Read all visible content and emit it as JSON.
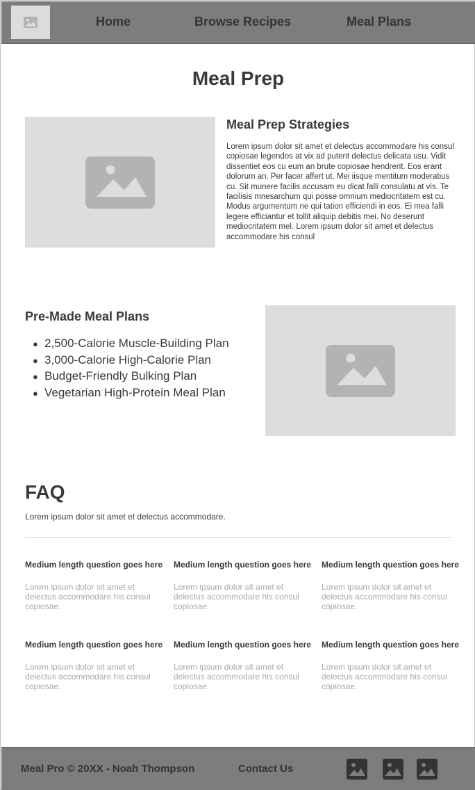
{
  "header": {
    "nav": [
      {
        "label": "Home"
      },
      {
        "label": "Browse Recipes"
      },
      {
        "label": "Meal Plans"
      }
    ]
  },
  "page_title": "Meal Prep",
  "strategies": {
    "heading": "Meal Prep Strategies",
    "body": "Lorem ipsum dolor sit amet et delectus accommodare his consul copiosae legendos at vix ad putent delectus delicata usu. Vidit dissentiet eos cu eum an brute copiosae hendrerit. Eos erant dolorum an. Per facer affert ut. Mei iisque mentitum moderatius cu. Sit munere facilis accusam eu dicat falli consulatu at vis. Te facilisis mnesarchum qui posse omnium mediocritatem est cu. Modus argumentum ne qui tation efficiendi in eos. Ei mea falli legere efficiantur et tollit aliquip debitis mei. No deserunt mediocritatem mel. Lorem ipsum dolor sit amet et delectus accommodare his consul",
    "image_icon": "image-placeholder-icon"
  },
  "meal_plans": {
    "heading": "Pre-Made Meal Plans",
    "bullet": "●",
    "items": [
      {
        "label": "2,500-Calorie Muscle-Building Plan"
      },
      {
        "label": "3,000-Calorie High-Calorie Plan"
      },
      {
        "label": "Budget-Friendly Bulking Plan"
      },
      {
        "label": "Vegetarian High-Protein Meal Plan"
      }
    ],
    "image_icon": "image-placeholder-icon"
  },
  "faq": {
    "title": "FAQ",
    "subtitle": "Lorem ipsum dolor sit amet et delectus accommodare.",
    "items": [
      {
        "question": "Medium length question goes here",
        "answer": "Lorem ipsum dolor sit amet et delectus accommodare his consul copiosae."
      },
      {
        "question": "Medium length question goes here",
        "answer": "Lorem ipsum dolor sit amet et delectus accommodare his consul copiosae."
      },
      {
        "question": "Medium length question goes here",
        "answer": "Lorem ipsum dolor sit amet et delectus accommodare his consul copiosae."
      },
      {
        "question": "Medium length question goes here",
        "answer": "Lorem ipsum dolor sit amet et delectus accommodare his consul copiosae."
      },
      {
        "question": "Medium length question goes here",
        "answer": "Lorem ipsum dolor sit amet et delectus accommodare his consul copiosae."
      },
      {
        "question": "Medium length question goes here",
        "answer": "Lorem ipsum dolor sit amet et delectus accommodare his consul copiosae."
      }
    ]
  },
  "footer": {
    "copyright": "Meal Pro © 20XX - Noah Thompson",
    "contact": "Contact Us",
    "social_icons": [
      "image-icon",
      "image-icon",
      "image-icon"
    ]
  },
  "colors": {
    "header_bg": "#7d7d7d",
    "placeholder_bg": "#dddddd",
    "placeholder_icon": "#b3b3b3",
    "text": "#3a3a3a",
    "muted_text": "#a8a8a8"
  }
}
